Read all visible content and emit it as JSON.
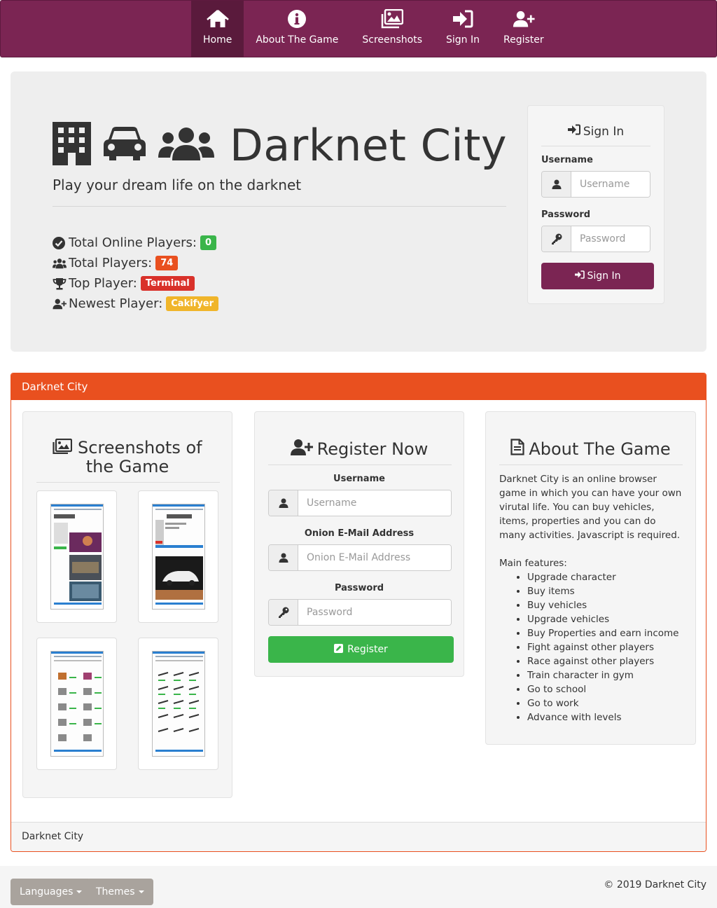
{
  "nav": {
    "items": [
      {
        "label": "Home",
        "icon": "home-icon"
      },
      {
        "label": "About The Game",
        "icon": "info-circle-icon"
      },
      {
        "label": "Screenshots",
        "icon": "images-icon"
      },
      {
        "label": "Sign In",
        "icon": "sign-in-icon"
      },
      {
        "label": "Register",
        "icon": "user-plus-icon"
      }
    ],
    "active": "Home"
  },
  "hero": {
    "title": "Darknet City",
    "subtitle": "Play your dream life on the darknet",
    "icons": [
      "building-icon",
      "car-icon",
      "users-icon"
    ],
    "stats": [
      {
        "label": "Total Online Players:",
        "value": "0",
        "icon": "check-circle-icon",
        "color": "#3ab54a"
      },
      {
        "label": "Total Players:",
        "value": "74",
        "icon": "users-icon",
        "color": "#e9501f"
      },
      {
        "label": "Top Player:",
        "value": "Terminal",
        "icon": "trophy-icon",
        "color": "#d9312a"
      },
      {
        "label": "Newest Player:",
        "value": "Cakifyer",
        "icon": "user-plus-icon",
        "color": "#f0b52a"
      }
    ]
  },
  "signin": {
    "heading": "Sign In",
    "username_label": "Username",
    "username_placeholder": "Username",
    "password_label": "Password",
    "password_placeholder": "Password",
    "button": "Sign In"
  },
  "panel": {
    "heading": "Darknet City",
    "footer": "Darknet City"
  },
  "screenshots": {
    "heading": "Screenshots of the Game"
  },
  "register": {
    "heading": "Register Now",
    "username_label": "Username",
    "username_placeholder": "Username",
    "email_label": "Onion E-Mail Address",
    "email_placeholder": "Onion E-Mail Address",
    "password_label": "Password",
    "password_placeholder": "Password",
    "button": "Register"
  },
  "about": {
    "heading": "About The Game",
    "description": "Darknet City is an online browser game in which you can have your own virutal life. You can buy vehicles, items, properties and you can do many activities. Javascript is required.",
    "features_label": "Main features:",
    "features": [
      "Upgrade character",
      "Buy items",
      "Buy vehicles",
      "Upgrade vehicles",
      "Buy Properties and earn income",
      "Fight against other players",
      "Race against other players",
      "Train character in gym",
      "Go to school",
      "Go to work",
      "Advance with levels"
    ]
  },
  "footer": {
    "languages": "Languages",
    "themes": "Themes",
    "copyright": "© 2019 Darknet City"
  },
  "colors": {
    "brand": "#7b2553",
    "panel_accent": "#e9501f",
    "success": "#3ab54a"
  }
}
